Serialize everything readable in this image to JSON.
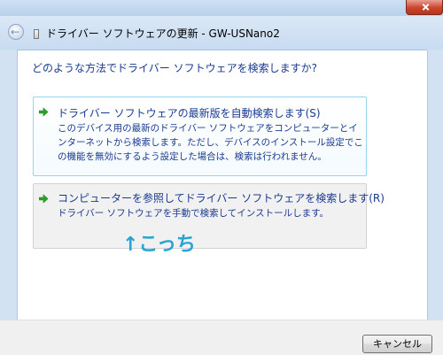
{
  "window": {
    "title": "ドライバー ソフトウェアの更新 - GW-USNano2",
    "back_icon": "back-arrow-icon",
    "close_icon": "close-icon"
  },
  "main": {
    "question": "どのような方法でドライバー ソフトウェアを検索しますか?",
    "options": [
      {
        "title": "ドライバー ソフトウェアの最新版を自動検索します(S)",
        "description": "このデバイス用の最新のドライバー ソフトウェアをコンピューターとインターネットから検索します。ただし、デバイスのインストール設定でこの機能を無効にするよう設定した場合は、検索は行われません。",
        "icon": "green-arrow-icon"
      },
      {
        "title": "コンピューターを参照してドライバー ソフトウェアを検索します(R)",
        "description": "ドライバー ソフトウェアを手動で検索してインストールします。",
        "icon": "green-arrow-icon"
      }
    ],
    "annotation": "↑こっち"
  },
  "footer": {
    "cancel_label": "キャンセル"
  },
  "colors": {
    "link_blue": "#1a3a8f",
    "annotation_cyan": "#27a3d4",
    "highlight_border": "#94d7ef",
    "arrow_green": "#2aa52a"
  }
}
